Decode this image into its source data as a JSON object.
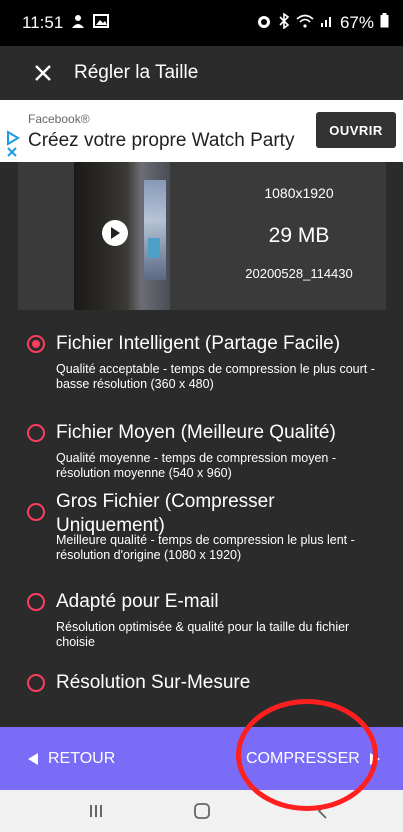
{
  "status_bar": {
    "time": "11:51",
    "battery": "67%",
    "icons": [
      "user-icon",
      "image-icon",
      "alarm-icon",
      "bluetooth-icon",
      "wifi-icon",
      "signal-icon",
      "battery-icon"
    ]
  },
  "app_bar": {
    "title": "Régler la Taille",
    "close_icon": "close-icon"
  },
  "ad": {
    "brand": "Facebook®",
    "headline": "Créez votre propre Watch Party",
    "cta": "OUVRIR"
  },
  "video": {
    "resolution": "1080x1920",
    "size": "29 MB",
    "name": "20200528_114430"
  },
  "options": [
    {
      "title": "Fichier Intelligent (Partage Facile)",
      "description": "Qualité acceptable - temps de compression le plus court - basse résolution (360 x 480)",
      "selected": true
    },
    {
      "title": "Fichier Moyen (Meilleure Qualité)",
      "description": "Qualité moyenne - temps de compression moyen - résolution moyenne (540 x 960)",
      "selected": false
    },
    {
      "title": "Gros Fichier (Compresser Uniquement)",
      "description": "Meilleure qualité - temps de compression le plus lent - résolution d'origine (1080 x 1920)",
      "selected": false
    },
    {
      "title": "Adapté pour E-mail",
      "description": "Résolution optimisée & qualité pour la taille du fichier choisie",
      "selected": false
    },
    {
      "title": "Résolution Sur-Mesure",
      "description": "",
      "selected": false
    }
  ],
  "bottom_bar": {
    "back_label": "RETOUR",
    "compress_label": "COMPRESSER"
  },
  "colors": {
    "accent": "#ff3e5f",
    "bottom_bar": "#7a6cf6",
    "annotation": "#ff1f1f"
  }
}
